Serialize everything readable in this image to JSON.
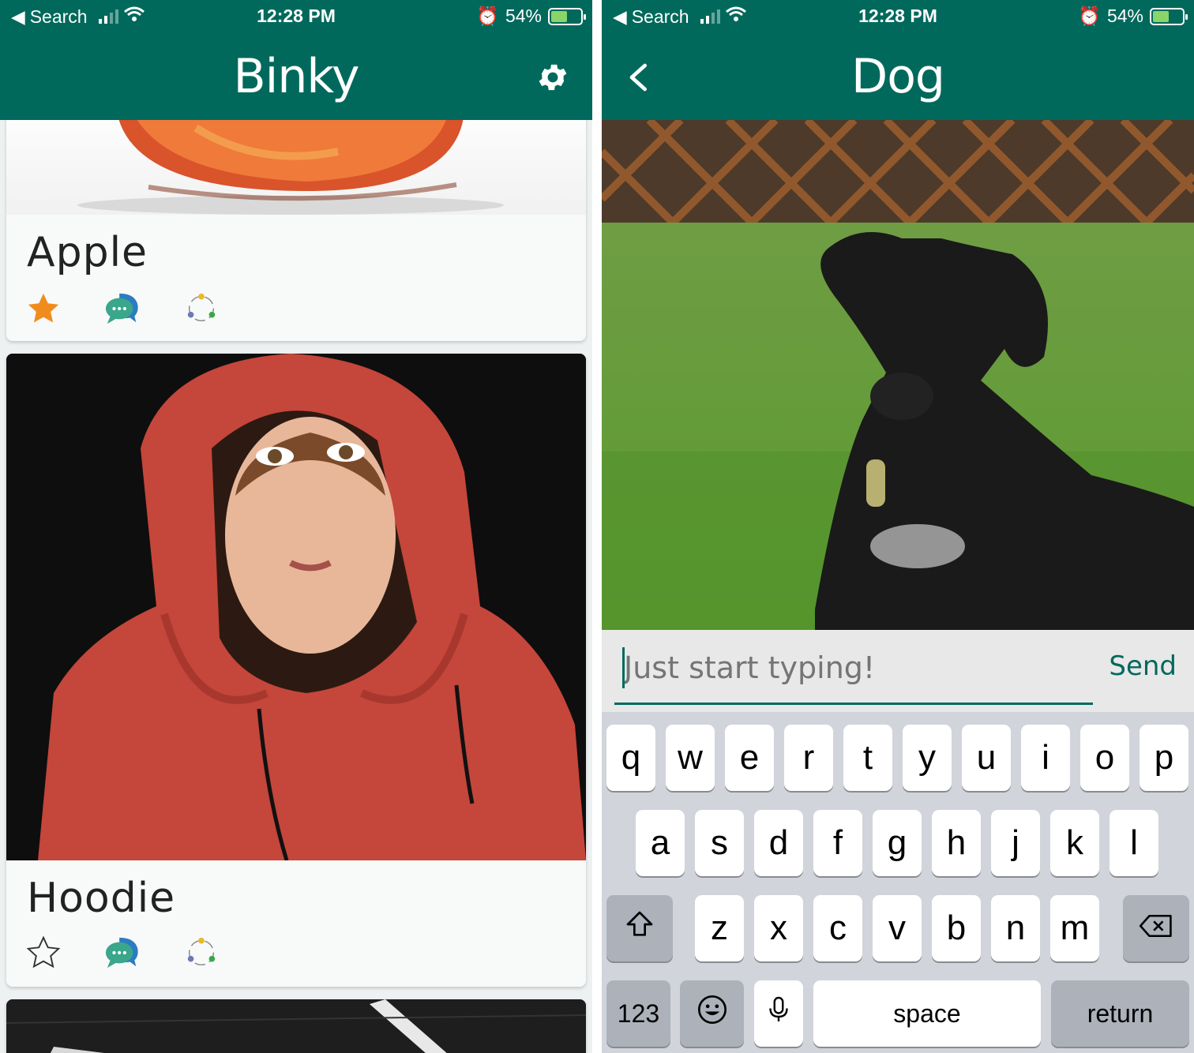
{
  "left": {
    "status": {
      "back_label": "Search",
      "time": "12:28 PM",
      "battery": "54%",
      "battery_level": 0.54
    },
    "title": "Binky",
    "cards": [
      {
        "title": "Apple",
        "favorite": true
      },
      {
        "title": "Hoodie",
        "favorite": false
      }
    ]
  },
  "right": {
    "status": {
      "back_label": "Search",
      "time": "12:28 PM",
      "battery": "54%",
      "battery_level": 0.54
    },
    "title": "Dog",
    "input": {
      "placeholder": "Just start typing!",
      "send_label": "Send"
    },
    "keyboard": {
      "row1": [
        "q",
        "w",
        "e",
        "r",
        "t",
        "y",
        "u",
        "i",
        "o",
        "p"
      ],
      "row2": [
        "a",
        "s",
        "d",
        "f",
        "g",
        "h",
        "j",
        "k",
        "l"
      ],
      "row3": [
        "z",
        "x",
        "c",
        "v",
        "b",
        "n",
        "m"
      ],
      "numbers": "123",
      "space": "space",
      "return": "return"
    }
  },
  "colors": {
    "primary": "#00695c",
    "star": "#f08c1e"
  }
}
